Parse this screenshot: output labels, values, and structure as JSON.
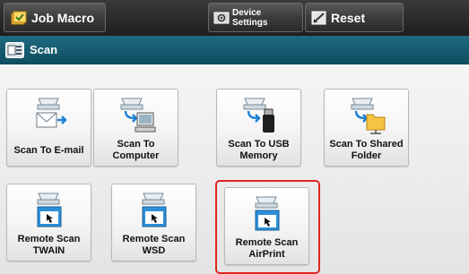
{
  "toolbar": {
    "job_macro_label": "Job Macro",
    "device_settings_line1": "Device",
    "device_settings_line2": "Settings",
    "reset_label": "Reset"
  },
  "header": {
    "title": "Scan"
  },
  "tiles": [
    {
      "label": "Scan To E-mail",
      "icon": "scan-to-email-icon"
    },
    {
      "label": "Scan To Computer",
      "icon": "scan-to-computer-icon"
    },
    {
      "label": "Scan To USB Memory",
      "icon": "scan-to-usb-icon"
    },
    {
      "label": "Scan To Shared Folder",
      "icon": "scan-to-shared-folder-icon"
    },
    {
      "label": "Remote Scan TWAIN",
      "icon": "remote-scan-icon"
    },
    {
      "label": "Remote Scan WSD",
      "icon": "remote-scan-icon"
    },
    {
      "label": "Remote Scan AirPrint",
      "icon": "remote-scan-icon",
      "highlighted": true
    }
  ],
  "colors": {
    "highlight": "#e0251f",
    "header": "#1e6a80"
  }
}
